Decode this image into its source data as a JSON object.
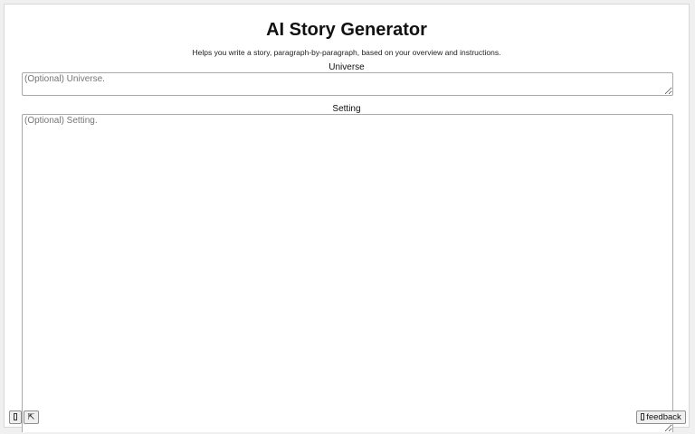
{
  "header": {
    "title": "AI Story Generator",
    "subtitle": "Helps you write a story, paragraph-by-paragraph, based on your overview and instructions."
  },
  "fields": {
    "universe": {
      "label": "Universe",
      "placeholder": "(Optional) Universe.",
      "value": ""
    },
    "setting": {
      "label": "Setting",
      "placeholder": "(Optional) Setting.",
      "value": ""
    }
  },
  "footer": {
    "menu_icon": "tofu-glyph-icon",
    "collapse_icon": "arrow-up-left-icon",
    "collapse_glyph": "⇱",
    "feedback_label": "feedback"
  }
}
